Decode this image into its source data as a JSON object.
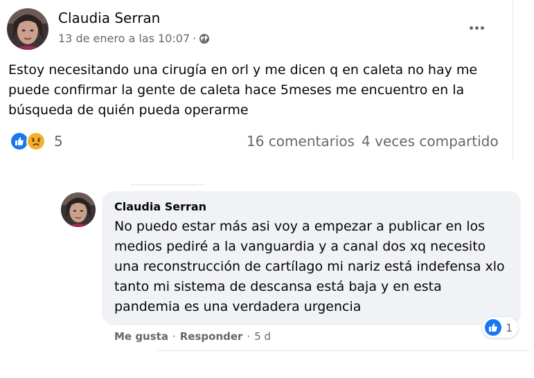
{
  "post": {
    "author": "Claudia Serran",
    "timestamp": "13 de enero a las 10:07",
    "separator": "·",
    "audience_icon": "globe-icon",
    "menu_icon": "more-options-icon",
    "text": "Estoy necesitando una cirugía en orl y me dicen q en caleta no hay me puede confirmar la gente de caleta hace 5meses me encuentro en la búsqueda de quién pueda operarme",
    "reactions": {
      "icons": [
        "like-icon",
        "sad-icon"
      ],
      "count": "5"
    },
    "comments_label": "16 comentarios",
    "shares_label": "4 veces compartido"
  },
  "comment": {
    "author": "Claudia Serran",
    "text": "No puedo estar más asi voy a empezar a publicar en los medios pediré a la vanguardia y a canal dos xq necesito una reconstrucción de cartílago mi nariz está indefensa xlo tanto mi sistema de descansa está baja y en esta pandemia es una verdadera urgencia",
    "reaction_icon": "like-icon",
    "reaction_count": "1",
    "like_label": "Me gusta",
    "reply_label": "Responder",
    "dot": "·",
    "age": "5 d"
  },
  "colors": {
    "like_blue": "#1877f2",
    "sad_yellow": "#f7b125",
    "secondary_text": "#65676b",
    "bubble_bg": "#f0f2f5"
  }
}
